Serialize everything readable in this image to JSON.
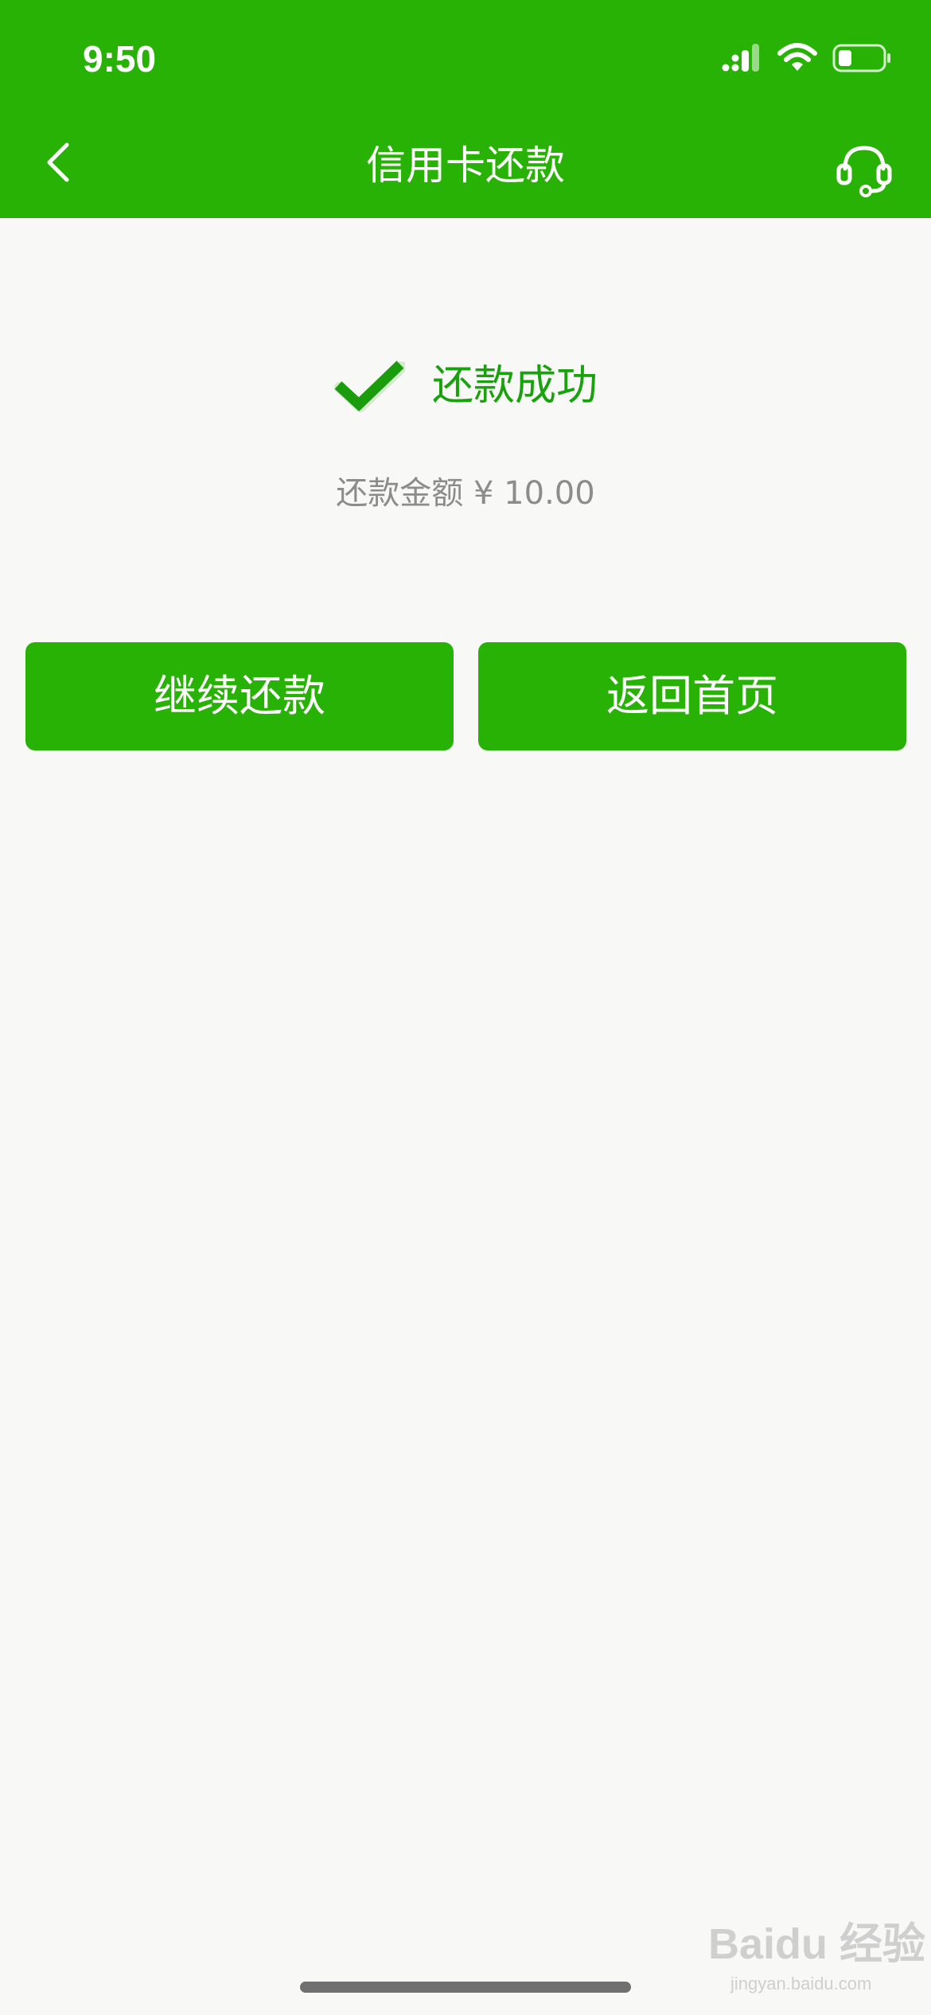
{
  "status_bar": {
    "time": "9:50",
    "icons": [
      "signal-icon",
      "wifi-icon",
      "battery-icon"
    ]
  },
  "nav": {
    "title": "信用卡还款",
    "back_icon": "chevron-left-icon",
    "service_icon": "headset-icon"
  },
  "result": {
    "status_icon": "checkmark-icon",
    "status_text": "还款成功",
    "amount_text": "还款金额 ¥ 10.00"
  },
  "actions": {
    "continue_label": "继续还款",
    "home_label": "返回首页"
  },
  "watermark": {
    "text": "Baidu 经验",
    "sub": "jingyan.baidu.com"
  },
  "colors": {
    "brand_green": "#28b206",
    "success_green": "#1aa20e",
    "amount_gray": "#8c8c8c",
    "background": "#f8f8f6"
  }
}
